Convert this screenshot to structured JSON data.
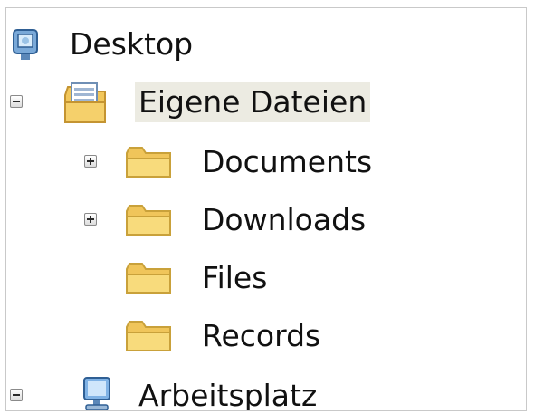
{
  "tree": {
    "items": [
      {
        "label": "Desktop",
        "icon": "desktop-icon",
        "expander": "none"
      },
      {
        "label": "Eigene Dateien",
        "icon": "my-documents-icon",
        "expander": "expanded",
        "selected": true
      },
      {
        "label": "Documents",
        "icon": "folder-icon",
        "expander": "collapsed"
      },
      {
        "label": "Downloads",
        "icon": "folder-icon",
        "expander": "collapsed"
      },
      {
        "label": "Files",
        "icon": "folder-icon",
        "expander": "none"
      },
      {
        "label": "Records",
        "icon": "folder-icon",
        "expander": "none"
      },
      {
        "label": "Arbeitsplatz",
        "icon": "my-computer-icon",
        "expander": "expanded"
      }
    ]
  },
  "colors": {
    "selection_bg": "#ecebe2",
    "folder_fill": "#f4d06c",
    "folder_edge": "#c9a13a"
  }
}
